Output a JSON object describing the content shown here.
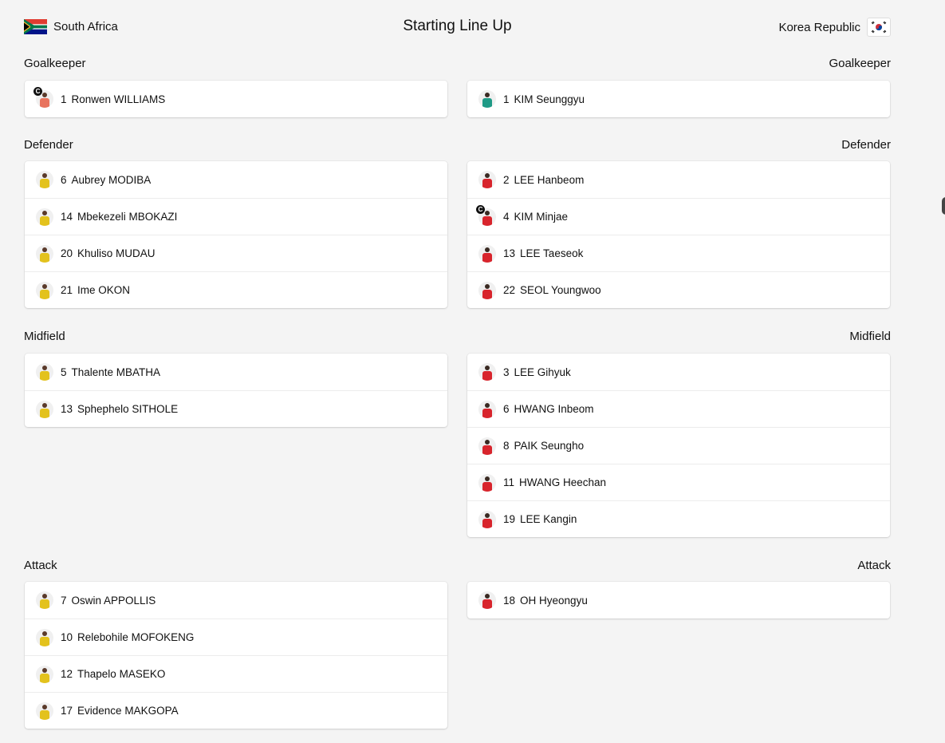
{
  "header": {
    "title": "Starting Line Up",
    "home_team": "South Africa",
    "away_team": "Korea Republic"
  },
  "colors": {
    "home_shirt": "#e3c21d",
    "home_gk_shirt": "#e8735e",
    "away_shirt": "#d8242c",
    "away_gk_shirt": "#1f9a86",
    "background": "#f4f4f4"
  },
  "sections": [
    {
      "label": "Goalkeeper",
      "home": [
        {
          "number": "1",
          "name": "Ronwen WILLIAMS",
          "captain": true,
          "gk": true
        }
      ],
      "away": [
        {
          "number": "1",
          "name": "KIM Seunggyu",
          "captain": false,
          "gk": true
        }
      ]
    },
    {
      "label": "Defender",
      "home": [
        {
          "number": "6",
          "name": "Aubrey MODIBA"
        },
        {
          "number": "14",
          "name": "Mbekezeli MBOKAZI"
        },
        {
          "number": "20",
          "name": "Khuliso MUDAU"
        },
        {
          "number": "21",
          "name": "Ime OKON"
        }
      ],
      "away": [
        {
          "number": "2",
          "name": "LEE Hanbeom"
        },
        {
          "number": "4",
          "name": "KIM Minjae",
          "captain": true
        },
        {
          "number": "13",
          "name": "LEE Taeseok"
        },
        {
          "number": "22",
          "name": "SEOL Youngwoo"
        }
      ]
    },
    {
      "label": "Midfield",
      "home": [
        {
          "number": "5",
          "name": "Thalente MBATHA"
        },
        {
          "number": "13",
          "name": "Sphephelo SITHOLE"
        }
      ],
      "away": [
        {
          "number": "3",
          "name": "LEE Gihyuk"
        },
        {
          "number": "6",
          "name": "HWANG Inbeom"
        },
        {
          "number": "8",
          "name": "PAIK Seungho"
        },
        {
          "number": "11",
          "name": "HWANG Heechan"
        },
        {
          "number": "19",
          "name": "LEE Kangin"
        }
      ]
    },
    {
      "label": "Attack",
      "home": [
        {
          "number": "7",
          "name": "Oswin APPOLLIS"
        },
        {
          "number": "10",
          "name": "Relebohile MOFOKENG"
        },
        {
          "number": "12",
          "name": "Thapelo MASEKO"
        },
        {
          "number": "17",
          "name": "Evidence MAKGOPA"
        }
      ],
      "away": [
        {
          "number": "18",
          "name": "OH Hyeongyu"
        }
      ]
    }
  ]
}
